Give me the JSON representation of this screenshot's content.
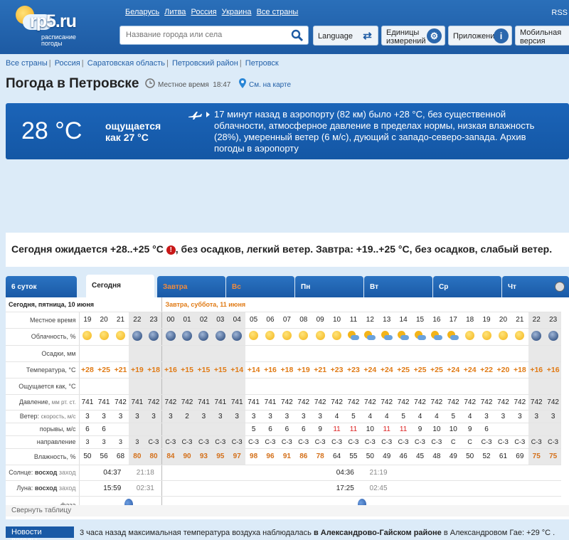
{
  "header": {
    "logo_text": "rp5.ru",
    "logo_sub": "расписание погоды",
    "countries": [
      "Беларусь",
      "Литва",
      "Россия",
      "Украина",
      "Все страны"
    ],
    "rss": "RSS",
    "search_placeholder": "Название города или села",
    "language": "Language",
    "units": "Единицы измерений",
    "apps": "Приложения",
    "mobile": "Мобильная версия"
  },
  "breadcrumbs": [
    "Все страны",
    "Россия",
    "Саратовская область",
    "Петровский район",
    "Петровск"
  ],
  "page": {
    "title": "Погода в Петровске",
    "local_time_label": "Местное время",
    "local_time": "18:47",
    "map_link": "См. на карте"
  },
  "current": {
    "temp": "28 °C",
    "feels_like": "ощущается как 27 °C",
    "report": "17 минут назад в аэропорту (82 км) было +28 °C, без существенной облачности, атмосферное давление в пределах нормы, низкая влажность (28%), умеренный ветер (6 м/с), дующий с западо-северо-запада. Архив погоды в аэропорту"
  },
  "summary": {
    "part1": "Сегодня ожидается +28..+25 °C",
    "part2": ", без осадков, легкий ветер. Завтра: +19..+25 °C, без осадков, слабый ветер."
  },
  "tabs": [
    "6 суток",
    "Сегодня",
    "Завтра",
    "Вс",
    "Пн",
    "Вт",
    "Ср",
    "Чт"
  ],
  "forecast": {
    "day_today": "Сегодня, пятница, 10 июня",
    "day_tomorrow": "Завтра, суббота, 11 июня",
    "labels": {
      "time": "Местное время",
      "clouds": "Облачность, %",
      "precip": "Осадки, мм",
      "temp": "Температура, °C",
      "feels": "Ощущается как, °C",
      "pressure_a": "Давление,",
      "pressure_b": "мм рт. ст.",
      "wind_a": "Ветер:",
      "wind_b": "скорость, м/с",
      "gusts": "порывы, м/с",
      "direction": "направление",
      "humidity": "Влажность, %",
      "sun_a": "Солнце:",
      "sun_b": "восход",
      "sun_c": "заход",
      "moon_a": "Луна:",
      "moon_b": "восход",
      "moon_c": "заход",
      "phase": "фаза"
    },
    "hours": [
      "19",
      "20",
      "21",
      "22",
      "23",
      "00",
      "01",
      "02",
      "03",
      "04",
      "05",
      "06",
      "07",
      "08",
      "09",
      "10",
      "11",
      "12",
      "13",
      "14",
      "15",
      "16",
      "17",
      "18",
      "19",
      "20",
      "21",
      "22",
      "23"
    ],
    "night": [
      false,
      false,
      false,
      true,
      true,
      true,
      true,
      true,
      true,
      true,
      false,
      false,
      false,
      false,
      false,
      false,
      false,
      false,
      false,
      false,
      false,
      false,
      false,
      false,
      false,
      false,
      false,
      true,
      true
    ],
    "clouds": [
      "sun",
      "sun",
      "sun",
      "moon",
      "moon",
      "moon",
      "moon",
      "moon",
      "moon",
      "moon",
      "sun",
      "sun",
      "sun",
      "sun",
      "sun",
      "sun",
      "pc",
      "pc",
      "pc",
      "pc",
      "pc",
      "pc",
      "pc",
      "sun",
      "sun",
      "sun",
      "sun",
      "moon",
      "moon"
    ],
    "temp": [
      "+28",
      "+25",
      "+21",
      "+19",
      "+18",
      "+16",
      "+15",
      "+15",
      "+15",
      "+14",
      "+14",
      "+16",
      "+18",
      "+19",
      "+21",
      "+23",
      "+23",
      "+24",
      "+24",
      "+25",
      "+25",
      "+25",
      "+24",
      "+24",
      "+22",
      "+20",
      "+18",
      "+16",
      "+16"
    ],
    "pressure": [
      "741",
      "741",
      "742",
      "741",
      "742",
      "742",
      "742",
      "741",
      "741",
      "741",
      "741",
      "741",
      "742",
      "742",
      "742",
      "742",
      "742",
      "742",
      "742",
      "742",
      "742",
      "742",
      "742",
      "742",
      "742",
      "742",
      "742",
      "742",
      "742"
    ],
    "wind": [
      "3",
      "3",
      "3",
      "3",
      "3",
      "3",
      "2",
      "3",
      "3",
      "3",
      "3",
      "3",
      "3",
      "3",
      "3",
      "4",
      "5",
      "4",
      "4",
      "5",
      "4",
      "4",
      "5",
      "4",
      "3",
      "3",
      "3",
      "3",
      "3"
    ],
    "gusts": [
      "6",
      "6",
      "",
      "",
      "",
      "",
      "",
      "",
      "",
      "",
      "5",
      "6",
      "6",
      "6",
      "9",
      "11",
      "11",
      "10",
      "11",
      "11",
      "9",
      "10",
      "10",
      "9",
      "6",
      "",
      "",
      "",
      ""
    ],
    "gusts_red": [
      "11",
      "11"
    ],
    "direction": [
      "3",
      "3",
      "3",
      "3",
      "С-З",
      "С-З",
      "С-З",
      "С-З",
      "С-З",
      "С-З",
      "С-З",
      "С-З",
      "С-З",
      "С-З",
      "С-З",
      "С-З",
      "С-З",
      "С-З",
      "С-З",
      "С-З",
      "С-З",
      "С-З",
      "С",
      "С",
      "С-З",
      "С-З",
      "С-З",
      "С-З",
      "С-З"
    ],
    "humidity": [
      "50",
      "56",
      "68",
      "80",
      "80",
      "84",
      "90",
      "93",
      "95",
      "97",
      "98",
      "96",
      "91",
      "86",
      "78",
      "64",
      "55",
      "50",
      "49",
      "46",
      "45",
      "48",
      "49",
      "50",
      "52",
      "61",
      "69",
      "75",
      "75"
    ],
    "humidity_hot": [
      false,
      false,
      false,
      true,
      true,
      true,
      true,
      true,
      true,
      true,
      true,
      true,
      true,
      true,
      true,
      false,
      false,
      false,
      false,
      false,
      false,
      false,
      false,
      false,
      false,
      false,
      false,
      true,
      true
    ],
    "sunrise1": "04:37",
    "sunset1": "21:18",
    "moonrise1": "15:59",
    "moonset1": "02:31",
    "sunrise2": "04:36",
    "sunset2": "21:19",
    "moonrise2": "17:25",
    "moonset2": "02:45"
  },
  "collapse": "Свернуть таблицу",
  "news": {
    "label": "Новости погоды",
    "text_a": "3 часа назад максимальная температура воздуха наблюдалась ",
    "text_b": "в Александрово-Гайском районе",
    "text_c": " в Александровом Гае: +29 °С ."
  }
}
